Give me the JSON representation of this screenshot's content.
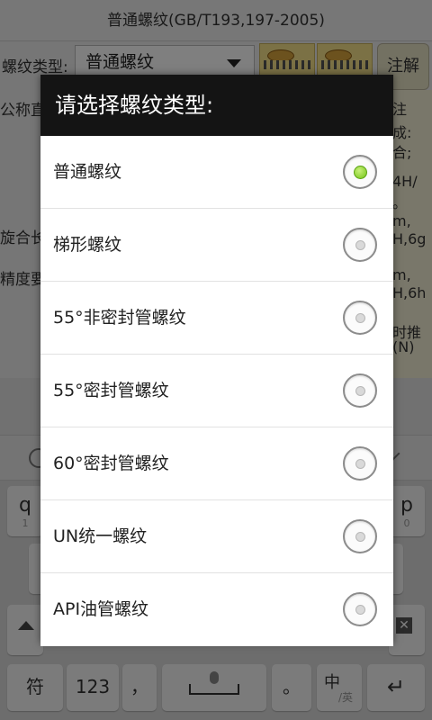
{
  "app": {
    "title": "普通螺纹(GB/T193,197-2005)",
    "type_label": "螺纹类型:",
    "type_value": "普通螺纹",
    "note_button": "注解",
    "labels": [
      "公称直",
      "旋合长",
      "精度要"
    ],
    "info_lines": [
      "注",
      "成:",
      "合;",
      "4H/",
      "。",
      "m,",
      "H,6g",
      "m,",
      "H,6h",
      "时推",
      "(N)"
    ]
  },
  "dialog": {
    "title": "请选择螺纹类型:",
    "options": [
      {
        "label": "普通螺纹",
        "selected": true
      },
      {
        "label": "梯形螺纹",
        "selected": false
      },
      {
        "label": "55°非密封管螺纹",
        "selected": false
      },
      {
        "label": "55°密封管螺纹",
        "selected": false
      },
      {
        "label": "60°密封管螺纹",
        "selected": false
      },
      {
        "label": "UN统一螺纹",
        "selected": false
      },
      {
        "label": "API油管螺纹",
        "selected": false
      }
    ]
  },
  "keyboard": {
    "left_key": {
      "main": "q",
      "sub": "1"
    },
    "right_key": {
      "main": "p",
      "sub": "0"
    },
    "bottom_row": [
      "符",
      "123",
      "，",
      "。"
    ],
    "lang_key_main": "中",
    "lang_key_sub": "/英"
  },
  "colors": {
    "dialog_header": "#141414",
    "overlay": "rgba(0,0,0,0.5)",
    "radio_selected": "#73c416"
  }
}
